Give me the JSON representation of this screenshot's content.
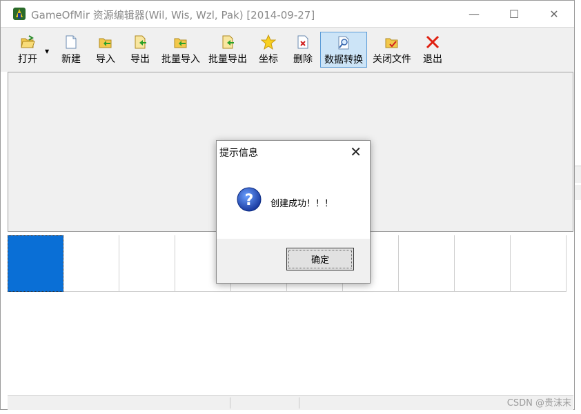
{
  "window": {
    "title": "GameOfMir 资源编辑器(Wil, Wis, Wzl, Pak) [2014-09-27]",
    "minimize": "—",
    "maximize": "☐",
    "close": "✕"
  },
  "toolbar": {
    "open": "打开",
    "new": "新建",
    "import": "导入",
    "export": "导出",
    "batch_import": "批量导入",
    "batch_export": "批量导出",
    "coords": "坐标",
    "delete": "删除",
    "convert": "数据转换",
    "close_file": "关闭文件",
    "exit": "退出"
  },
  "dialog": {
    "title": "提示信息",
    "close": "✕",
    "message": "创建成功！！！",
    "ok": "确定"
  },
  "watermark": "CSDN @贵沫末",
  "colors": {
    "selection": "#0a6fd6",
    "active_button": "#cce4f7"
  }
}
